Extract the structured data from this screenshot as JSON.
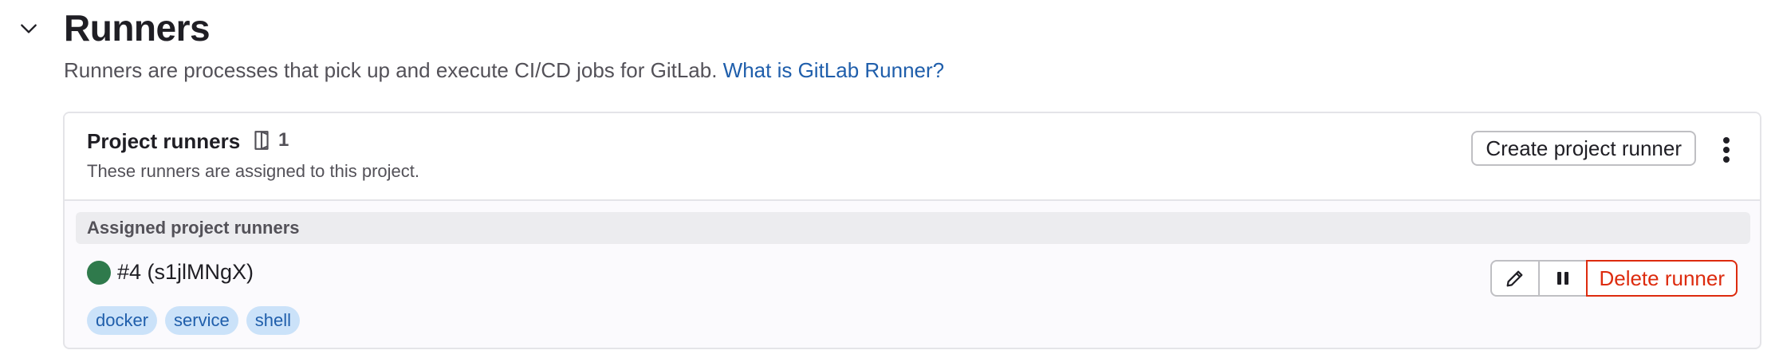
{
  "section": {
    "title": "Runners",
    "description": "Runners are processes that pick up and execute CI/CD jobs for GitLab. ",
    "help_link": "What is GitLab Runner?"
  },
  "card": {
    "title": "Project runners",
    "count": "1",
    "subtitle": "These runners are assigned to this project.",
    "create_button": "Create project runner",
    "group_label": "Assigned project runners"
  },
  "runner": {
    "name": "#4 (s1jlMNgX)",
    "status_color": "#2f7a4c",
    "tags": [
      "docker",
      "service",
      "shell"
    ],
    "delete_label": "Delete runner"
  },
  "icons": {
    "collapse": "chevron-down-icon",
    "count": "runner-icon",
    "menu": "kebab-menu-icon",
    "edit": "pencil-icon",
    "pause": "pause-icon"
  }
}
